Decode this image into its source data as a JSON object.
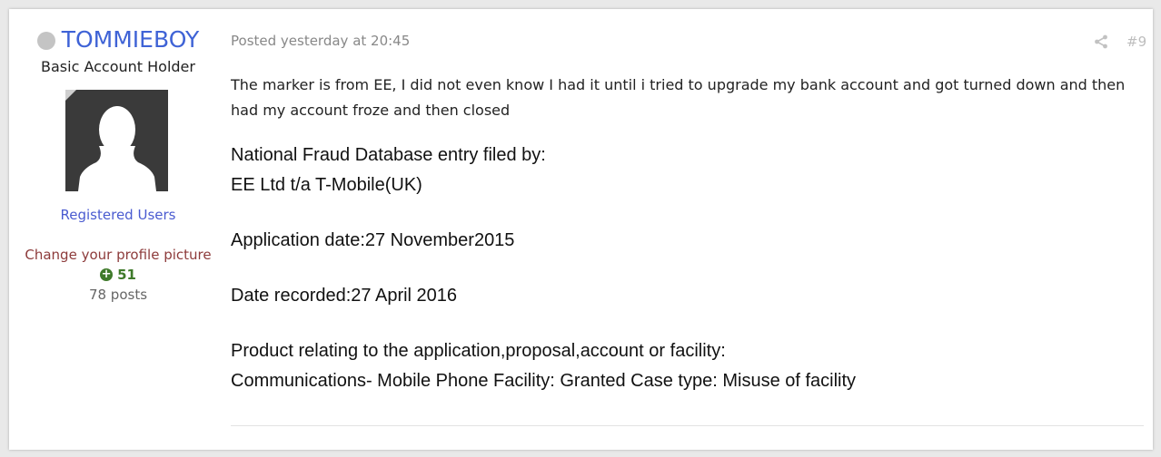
{
  "author": {
    "name": "TOMMIEBOY",
    "title": "Basic Account Holder",
    "group": "Registered Users",
    "change_picture": "Change your profile picture",
    "reputation": "51",
    "posts": "78 posts"
  },
  "post": {
    "meta": "Posted yesterday at 20:45",
    "number": "#9",
    "intro": "The marker is from EE, I did not even know I had it until i tried to upgrade my bank account and got turned down and then had my account froze and then closed",
    "lines": {
      "l1": "National Fraud Database entry filed by:",
      "l2": "EE Ltd t/a T-Mobile(UK)",
      "l3": "Application date:27 November2015",
      "l4": "Date recorded:27 April 2016",
      "l5": "Product relating to the application,proposal,account or facility:",
      "l6": "Communications- Mobile Phone Facility: Granted Case type: Misuse of facility"
    }
  },
  "colors": {
    "author_name": "#3f63d6",
    "group": "#4a5bd0",
    "change_picture": "#8d3b3b",
    "reputation": "#3f7a2a"
  },
  "icons": {
    "status": "offline-status-icon",
    "share": "share-icon",
    "reputation": "plus-circle-icon"
  }
}
